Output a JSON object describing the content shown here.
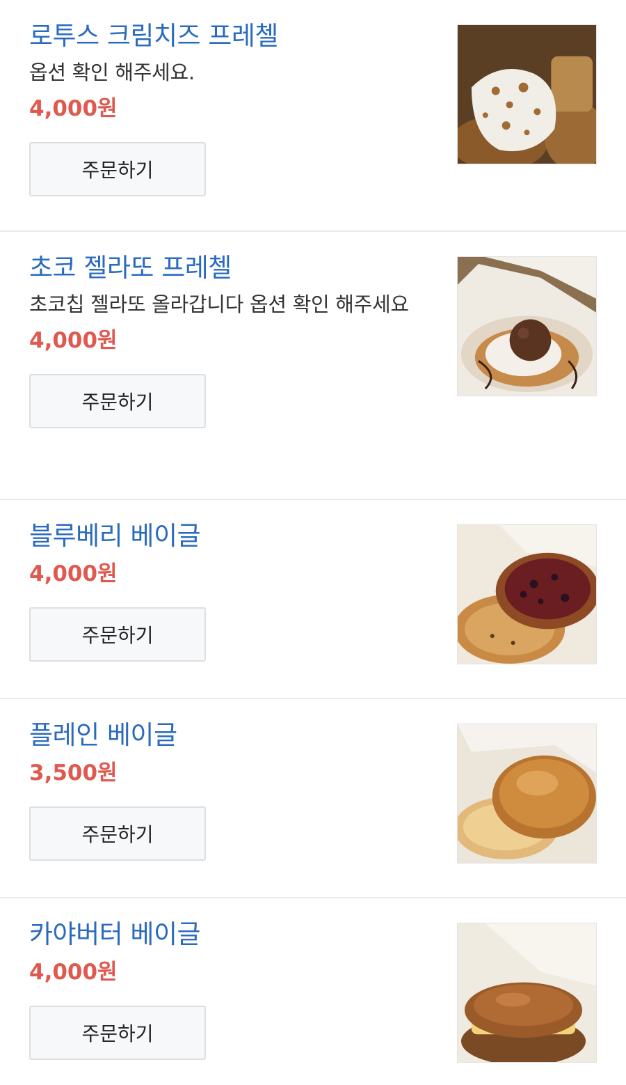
{
  "menu": {
    "items": [
      {
        "name": "로투스 크림치즈 프레첼",
        "description": "옵션 확인 해주세요.",
        "price": "4,000원",
        "order_label": "주문하기"
      },
      {
        "name": "초코 젤라또 프레첼",
        "description": "초코칩 젤라또 올라갑니다 옵션 확인 해주세요",
        "price": "4,000원",
        "order_label": "주문하기"
      },
      {
        "name": "블루베리 베이글",
        "price": "4,000원",
        "order_label": "주문하기"
      },
      {
        "name": "플레인 베이글",
        "price": "3,500원",
        "order_label": "주문하기"
      },
      {
        "name": "카야버터 베이글",
        "price": "4,000원",
        "order_label": "주문하기"
      }
    ]
  },
  "colors": {
    "item_name": "#2a6bbf",
    "price": "#e0594f",
    "button_bg": "#f7f8fa",
    "divider": "#ebebeb"
  }
}
